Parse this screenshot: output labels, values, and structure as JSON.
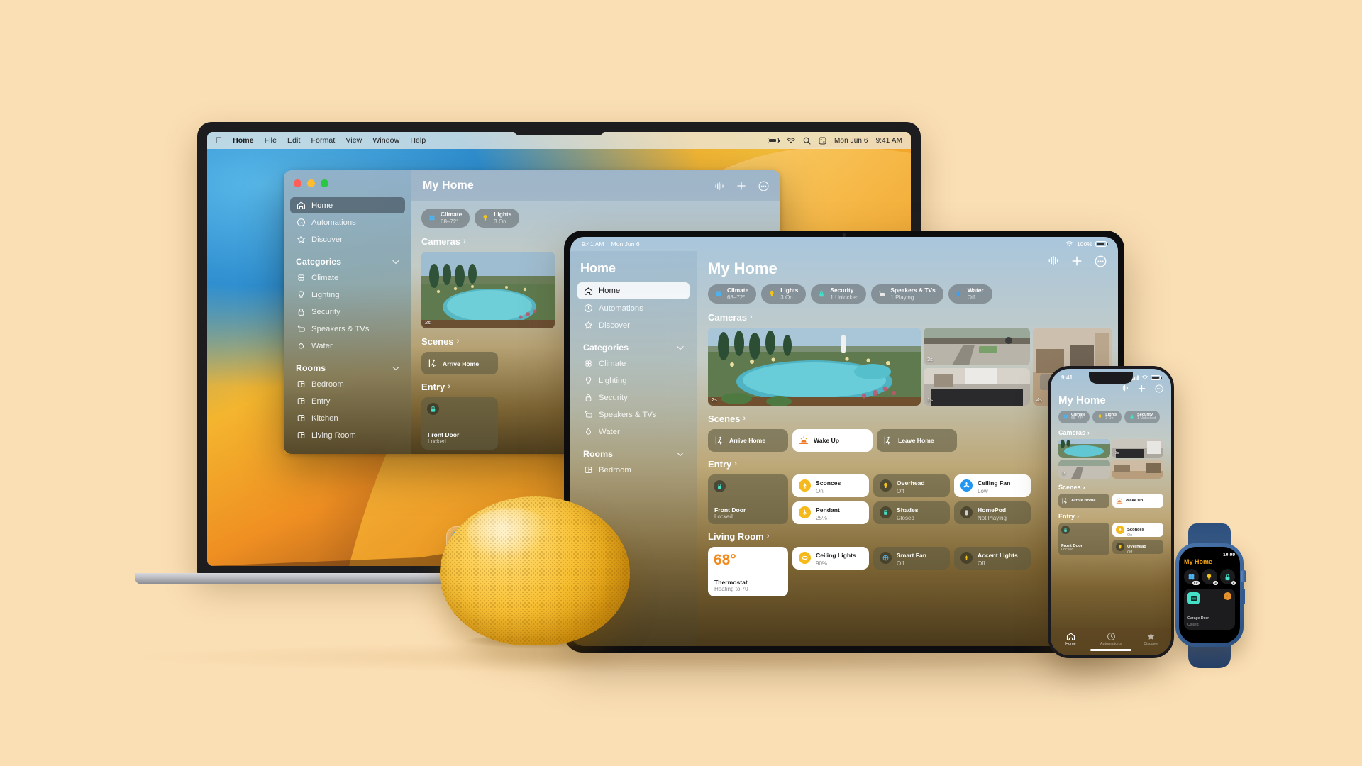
{
  "scene": {
    "background_color": "#fbdfb4",
    "devices": [
      "mac",
      "ipad",
      "iphone",
      "watch",
      "homepod"
    ]
  },
  "mac": {
    "menubar": {
      "apple_icon": "apple-icon",
      "items": [
        "Home",
        "File",
        "Edit",
        "Format",
        "View",
        "Window",
        "Help"
      ],
      "status_icons": [
        "battery-icon",
        "wifi-icon",
        "search-icon",
        "control-center-icon"
      ],
      "date": "Mon Jun 6",
      "time": "9:41 AM"
    },
    "window": {
      "title": "My Home",
      "toolbar_icons": [
        "siri-waveform-icon",
        "add-icon",
        "more-options-icon"
      ],
      "sidebar": {
        "primary": [
          {
            "label": "Home",
            "icon": "house-icon",
            "selected": true
          },
          {
            "label": "Automations",
            "icon": "automation-clock-icon",
            "selected": false
          },
          {
            "label": "Discover",
            "icon": "star-icon",
            "selected": false
          }
        ],
        "categories_header": "Categories",
        "categories": [
          {
            "label": "Climate",
            "icon": "fan-icon"
          },
          {
            "label": "Lighting",
            "icon": "bulb-icon"
          },
          {
            "label": "Security",
            "icon": "lock-icon"
          },
          {
            "label": "Speakers & TVs",
            "icon": "speaker-tv-icon"
          },
          {
            "label": "Water",
            "icon": "water-drop-icon"
          }
        ],
        "rooms_header": "Rooms",
        "rooms": [
          {
            "label": "Bedroom",
            "icon": "room-icon"
          },
          {
            "label": "Entry",
            "icon": "room-icon"
          },
          {
            "label": "Kitchen",
            "icon": "room-icon"
          },
          {
            "label": "Living Room",
            "icon": "room-icon"
          }
        ]
      },
      "status_pills": [
        {
          "title": "Climate",
          "subtitle": "68–72°",
          "icon": "fan-icon",
          "color": "#4cb3f0"
        },
        {
          "title": "Lights",
          "subtitle": "3 On",
          "icon": "bulb-icon",
          "color": "#f5c518"
        }
      ],
      "sections": {
        "cameras": {
          "title": "Cameras",
          "chevron": "›",
          "timestamps": [
            "2s"
          ]
        },
        "scenes": {
          "title": "Scenes",
          "chevron": "›",
          "items": [
            {
              "label": "Arrive Home",
              "icon": "walk-in-icon"
            }
          ]
        },
        "entry": {
          "title": "Entry",
          "chevron": "›",
          "items": [
            {
              "label": "Front Door",
              "state": "Locked",
              "icon": "lock-icon"
            }
          ]
        }
      }
    },
    "dock": [
      {
        "name": "finder-icon",
        "glyph": "🙂"
      },
      {
        "name": "launchpad-icon",
        "glyph": "▦"
      },
      {
        "name": "safari-icon",
        "glyph": "🧭"
      },
      {
        "name": "messages-icon",
        "glyph": "💬"
      },
      {
        "name": "mail-icon",
        "glyph": "✉"
      },
      {
        "name": "maps-icon",
        "glyph": "🗺"
      },
      {
        "name": "photos-icon",
        "glyph": "❀"
      }
    ]
  },
  "ipad": {
    "status_bar": {
      "time": "9:41 AM",
      "date": "Mon Jun 6",
      "wifi": "wifi-icon",
      "battery_percent": "100%"
    },
    "sidebar": {
      "title": "Home",
      "primary": [
        {
          "label": "Home",
          "icon": "house-icon",
          "selected": true
        },
        {
          "label": "Automations",
          "icon": "automation-clock-icon",
          "selected": false
        },
        {
          "label": "Discover",
          "icon": "star-icon",
          "selected": false
        }
      ],
      "categories_header": "Categories",
      "categories": [
        {
          "label": "Climate",
          "icon": "fan-icon"
        },
        {
          "label": "Lighting",
          "icon": "bulb-icon"
        },
        {
          "label": "Security",
          "icon": "lock-icon"
        },
        {
          "label": "Speakers & TVs",
          "icon": "speaker-tv-icon"
        },
        {
          "label": "Water",
          "icon": "water-drop-icon"
        }
      ],
      "rooms_header": "Rooms",
      "rooms": [
        {
          "label": "Bedroom",
          "icon": "room-icon"
        }
      ]
    },
    "main": {
      "title": "My Home",
      "toolbar_icons": [
        "siri-waveform-icon",
        "add-icon",
        "more-options-icon"
      ],
      "status_pills": [
        {
          "title": "Climate",
          "subtitle": "68–72°",
          "icon": "fan-icon",
          "color": "#4cb3f0"
        },
        {
          "title": "Lights",
          "subtitle": "3 On",
          "icon": "bulb-icon",
          "color": "#f5c518"
        },
        {
          "title": "Security",
          "subtitle": "1 Unlocked",
          "icon": "lock-icon",
          "color": "#45e0c8"
        },
        {
          "title": "Speakers & TVs",
          "subtitle": "1 Playing",
          "icon": "speaker-tv-icon",
          "color": "#e8e8e8"
        },
        {
          "title": "Water",
          "subtitle": "Off",
          "icon": "water-drop-icon",
          "color": "#3f9ef0"
        }
      ],
      "cameras": {
        "title": "Cameras",
        "chevron": "›",
        "timestamps": [
          "2s",
          "3s",
          "1s",
          "4s"
        ]
      },
      "scenes": {
        "title": "Scenes",
        "chevron": "›",
        "items": [
          {
            "label": "Arrive Home",
            "icon": "walk-in-icon",
            "active": false
          },
          {
            "label": "Wake Up",
            "icon": "sunrise-icon",
            "active": true
          },
          {
            "label": "Leave Home",
            "icon": "walk-out-icon",
            "active": false
          }
        ]
      },
      "entry": {
        "title": "Entry",
        "chevron": "›",
        "door": {
          "label": "Front Door",
          "state": "Locked",
          "icon": "lock-icon"
        },
        "tiles": [
          {
            "label": "Sconces",
            "state": "On",
            "icon": "sconce-icon",
            "on": true
          },
          {
            "label": "Overhead",
            "state": "Off",
            "icon": "bulb-icon",
            "on": false
          },
          {
            "label": "Ceiling Fan",
            "state": "Low",
            "icon": "fan-blade-icon",
            "on": true
          },
          {
            "label": "Pendant",
            "state": "25%",
            "icon": "pendant-icon",
            "on": true
          },
          {
            "label": "Shades",
            "state": "Closed",
            "icon": "shade-icon",
            "on": false
          },
          {
            "label": "HomePod",
            "state": "Not Playing",
            "icon": "homepod-icon",
            "on": false
          }
        ]
      },
      "living_room": {
        "title": "Living Room",
        "chevron": "›",
        "thermostat": {
          "temperature": "68°",
          "label": "Thermostat",
          "state": "Heating to 70"
        },
        "tiles": [
          {
            "label": "Ceiling Lights",
            "state": "90%",
            "icon": "ceiling-light-icon",
            "on": true
          },
          {
            "label": "Smart Fan",
            "state": "Off",
            "icon": "fan-blade-icon",
            "on": false
          },
          {
            "label": "Accent Lights",
            "state": "Off",
            "icon": "accent-light-icon",
            "on": false
          }
        ]
      }
    }
  },
  "iphone": {
    "status_bar": {
      "time": "9:41",
      "icons": [
        "cellular-icon",
        "wifi-icon",
        "battery-icon"
      ]
    },
    "toolbar_icons": [
      "siri-waveform-icon",
      "add-icon",
      "more-options-icon"
    ],
    "title": "My Home",
    "status_pills": [
      {
        "title": "Climate",
        "subtitle": "68–72°",
        "icon": "fan-icon",
        "color": "#4cb3f0"
      },
      {
        "title": "Lights",
        "subtitle": "3 On",
        "icon": "bulb-icon",
        "color": "#f5c518"
      },
      {
        "title": "Security",
        "subtitle": "1 Unlocked",
        "icon": "lock-icon",
        "color": "#45e0c8"
      }
    ],
    "cameras": {
      "title": "Cameras",
      "chevron": "›",
      "timestamps": [
        "3s",
        "1s"
      ]
    },
    "scenes": {
      "title": "Scenes",
      "chevron": "›",
      "items": [
        {
          "label": "Arrive Home",
          "icon": "walk-in-icon",
          "active": false
        },
        {
          "label": "Wake Up",
          "icon": "sunrise-icon",
          "active": true
        }
      ]
    },
    "entry": {
      "title": "Entry",
      "chevron": "›",
      "door": {
        "label": "Front Door",
        "state": "Locked",
        "icon": "lock-icon"
      },
      "tiles": [
        {
          "label": "Sconces",
          "state": "On",
          "icon": "sconce-icon",
          "on": true
        },
        {
          "label": "Overhead",
          "state": "Off",
          "icon": "bulb-icon",
          "on": false
        }
      ]
    },
    "tabbar": [
      {
        "label": "Home",
        "icon": "house-icon",
        "active": true
      },
      {
        "label": "Automations",
        "icon": "automation-clock-icon",
        "active": false
      },
      {
        "label": "Discover",
        "icon": "star-icon",
        "active": false
      }
    ]
  },
  "watch": {
    "time": "10:09",
    "title": "My Home",
    "status_icons": [
      {
        "name": "fan-icon",
        "badge": "67°",
        "color": "#4cb3f0"
      },
      {
        "name": "bulb-icon",
        "badge": "3",
        "color": "#f5c518"
      },
      {
        "name": "lock-icon",
        "badge": "1",
        "color": "#45e0c8"
      }
    ],
    "card": {
      "label": "Garage Door",
      "state": "Closed",
      "icon": "garage-door-icon",
      "accessory_icon": "more-options-icon"
    }
  },
  "homepod": {
    "name": "HomePod mini",
    "color": "#f7bf33"
  }
}
